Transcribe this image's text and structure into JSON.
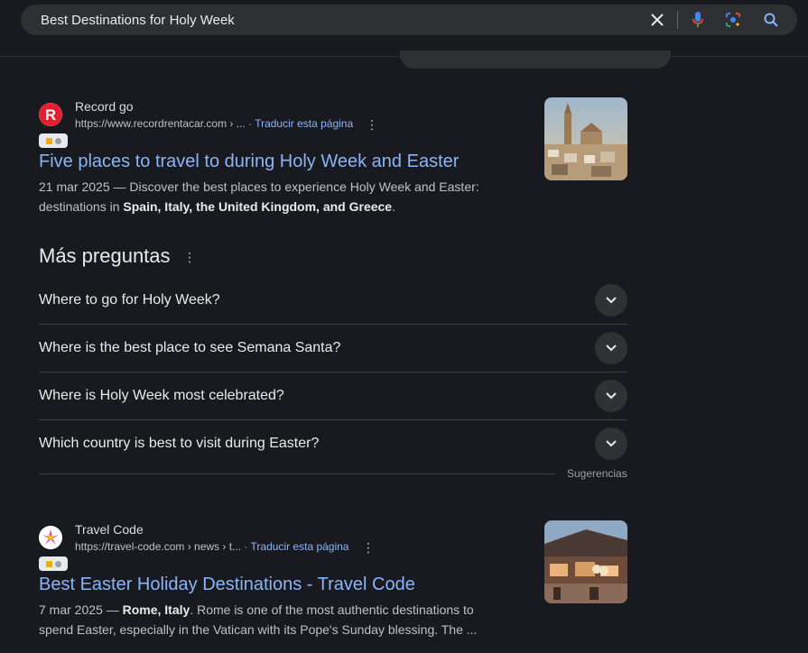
{
  "search": {
    "query": "Best Destinations for Holy Week"
  },
  "results": [
    {
      "site_name": "Record go",
      "url": "https://www.recordrentacar.com › ...",
      "translate": "Traducir esta página",
      "title": "Five places to travel to during Holy Week and Easter",
      "date": "21 mar 2025",
      "snippet_pre": " — Discover the best places to experience Holy Week and Easter: destinations in ",
      "snippet_bold": "Spain, Italy, the United Kingdom, and Greece",
      "snippet_post": ".",
      "favicon_letter": "R",
      "favicon_color": "#e5202e"
    },
    {
      "site_name": "Travel Code",
      "url": "https://travel-code.com › news › t...",
      "translate": "Traducir esta página",
      "title": "Best Easter Holiday Destinations - Travel Code",
      "date": "7 mar 2025",
      "snippet_pre": " — ",
      "snippet_bold": "Rome, Italy",
      "snippet_post": ". Rome is one of the most authentic destinations to spend Easter, especially in the Vatican with its Pope's Sunday blessing. The ..."
    }
  ],
  "paa": {
    "heading": "Más preguntas",
    "questions": [
      "Where to go for Holy Week?",
      "Where is the best place to see Semana Santa?",
      "Where is Holy Week most celebrated?",
      "Which country is best to visit during Easter?"
    ],
    "suggestions_label": "Sugerencias"
  },
  "colors": {
    "link": "#8ab4f8",
    "background": "#191a1f"
  }
}
